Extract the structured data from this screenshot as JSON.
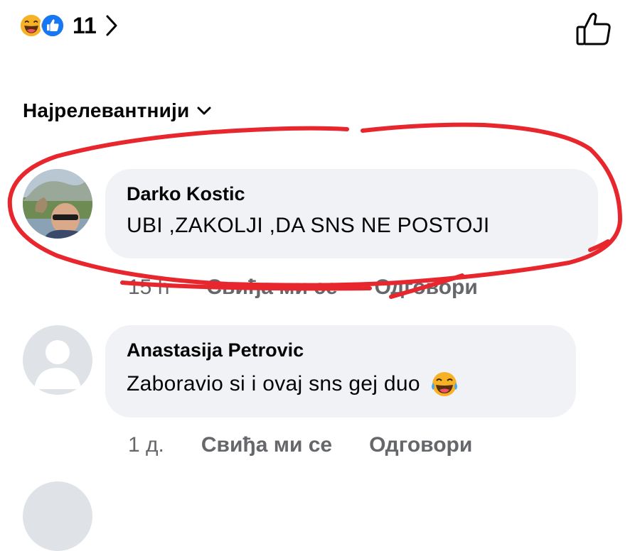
{
  "reactions": {
    "count": "11",
    "icons": [
      "laughing-emoji-icon",
      "like-thumb-icon"
    ],
    "colors": {
      "haha": "#f7b125",
      "like": "#1877f2"
    }
  },
  "sort": {
    "label": "Најрелевантнији"
  },
  "comments": [
    {
      "author": "Darko Kostic",
      "text": "UBI ,ZAKOLJI ,DA SNS NE POSTOJI",
      "time": "15 h",
      "like_label": "Свиђа ми се",
      "reply_label": "Одговори"
    },
    {
      "author": "Anastasija Petrovic",
      "text": "Zaboravio si i ovaj sns gej duo",
      "time": "1 д.",
      "like_label": "Свиђа ми се",
      "reply_label": "Одговори"
    }
  ],
  "annotation_color": "#e8262d"
}
